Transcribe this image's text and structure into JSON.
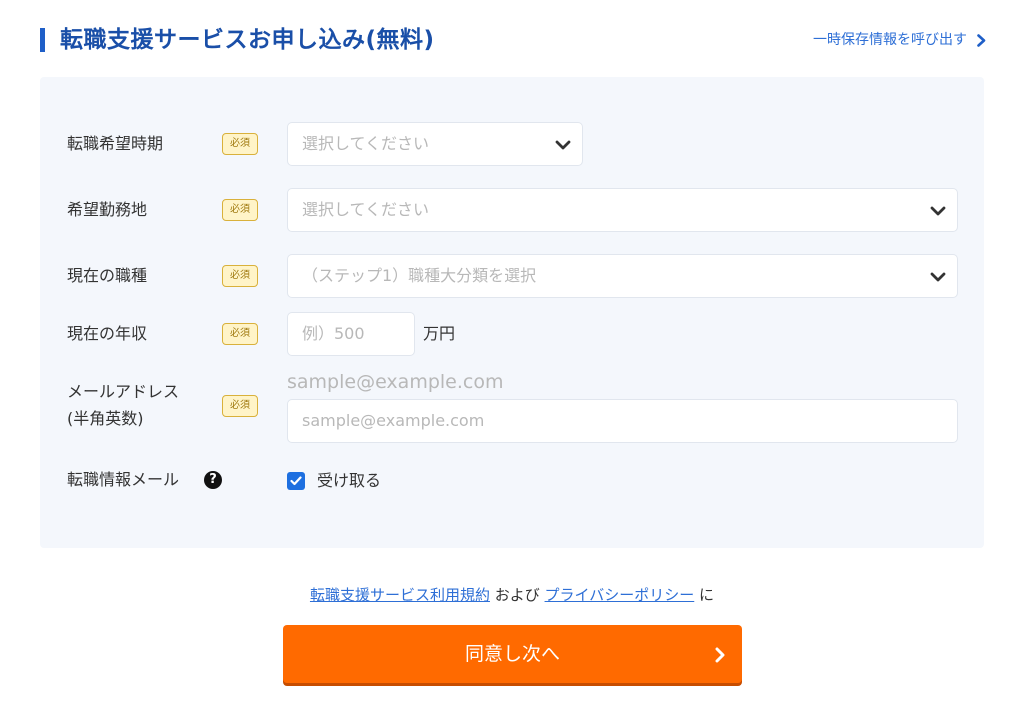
{
  "header": {
    "title": "転職支援サービスお申し込み(無料)",
    "resume_link": "一時保存情報を呼び出す"
  },
  "form": {
    "required_badge": "必須",
    "timing": {
      "label": "転職希望時期",
      "placeholder": "選択してください"
    },
    "location": {
      "label": "希望勤務地",
      "placeholder": "選択してください"
    },
    "occupation": {
      "label": "現在の職種",
      "placeholder": "（ステップ1）職種大分類を選択"
    },
    "income": {
      "label": "現在の年収",
      "placeholder": "例）500",
      "unit": "万円"
    },
    "email": {
      "label_line1": "メールアドレス",
      "label_line2": "(半角英数)",
      "hint": "sample@example.com",
      "placeholder": "sample@example.com"
    },
    "newsletter": {
      "label": "転職情報メール",
      "help_icon": "?",
      "checkbox_label": "受け取る",
      "checked": true
    }
  },
  "agreement": {
    "terms_link": "転職支援サービス利用規約",
    "and_text": "および",
    "privacy_link": "プライバシーポリシー",
    "suffix": "に"
  },
  "submit": {
    "label": "同意し次へ"
  },
  "colors": {
    "title": "#1a4fa8",
    "link": "#2e6fd6",
    "panel_bg": "#f4f7fc",
    "badge_bg": "#fff4c8",
    "badge_border": "#d9b13b",
    "checkbox": "#1d6fe0",
    "cta": "#ff6a00"
  },
  "icons": {
    "resume_link": "chevron-right-icon",
    "select": "chevron-down-icon",
    "help": "question-circle-icon",
    "checkbox": "check-icon",
    "cta": "chevron-right-icon"
  }
}
